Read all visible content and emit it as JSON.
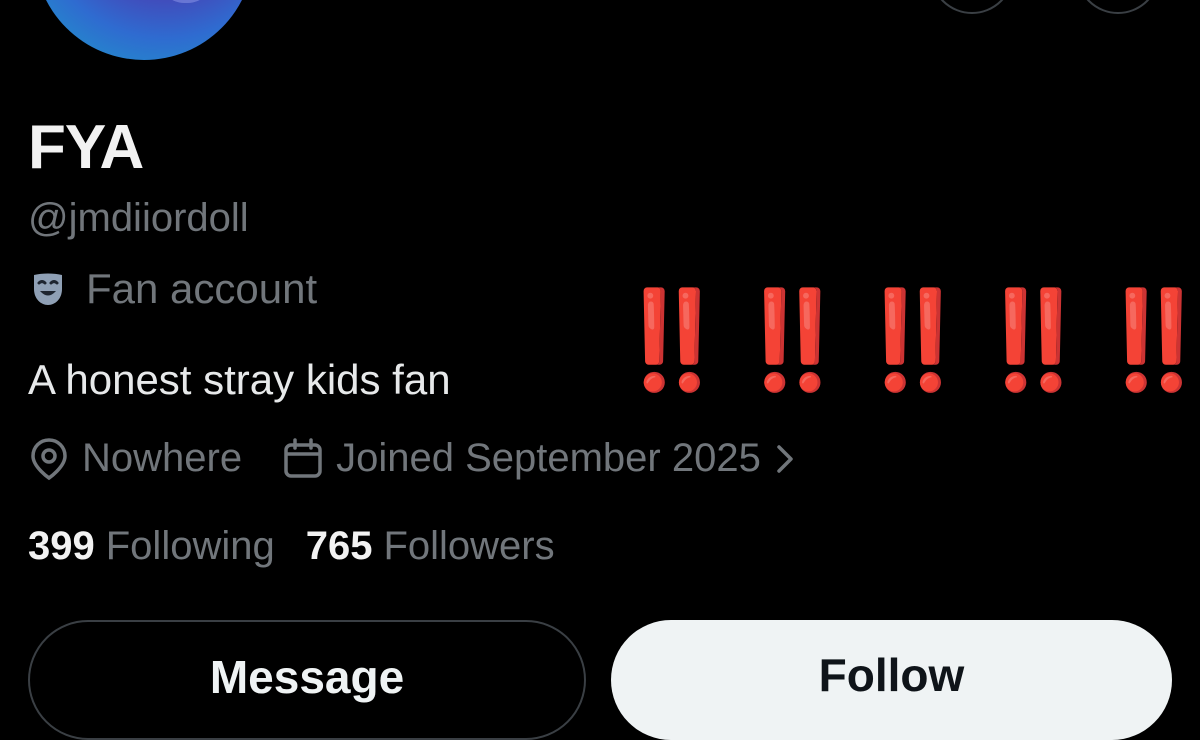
{
  "profile": {
    "display_name": "FYA",
    "handle": "@jmdiiordoll",
    "category": "Fan account",
    "category_icon": "theater-mask-icon",
    "bio": "A honest stray kids fan",
    "location": "Nowhere",
    "joined": "Joined September 2025"
  },
  "stats": {
    "following_count": "399",
    "following_label": "Following",
    "followers_count": "765",
    "followers_label": "Followers"
  },
  "annotation": {
    "text": "‼️‼️‼️‼️‼️",
    "color": "#ff1a0a"
  },
  "buttons": {
    "message": "Message",
    "follow": "Follow"
  },
  "colors": {
    "background": "#000000",
    "text_primary": "#e7e9ea",
    "text_secondary": "#71767b",
    "follow_button_bg": "#eff3f4"
  }
}
